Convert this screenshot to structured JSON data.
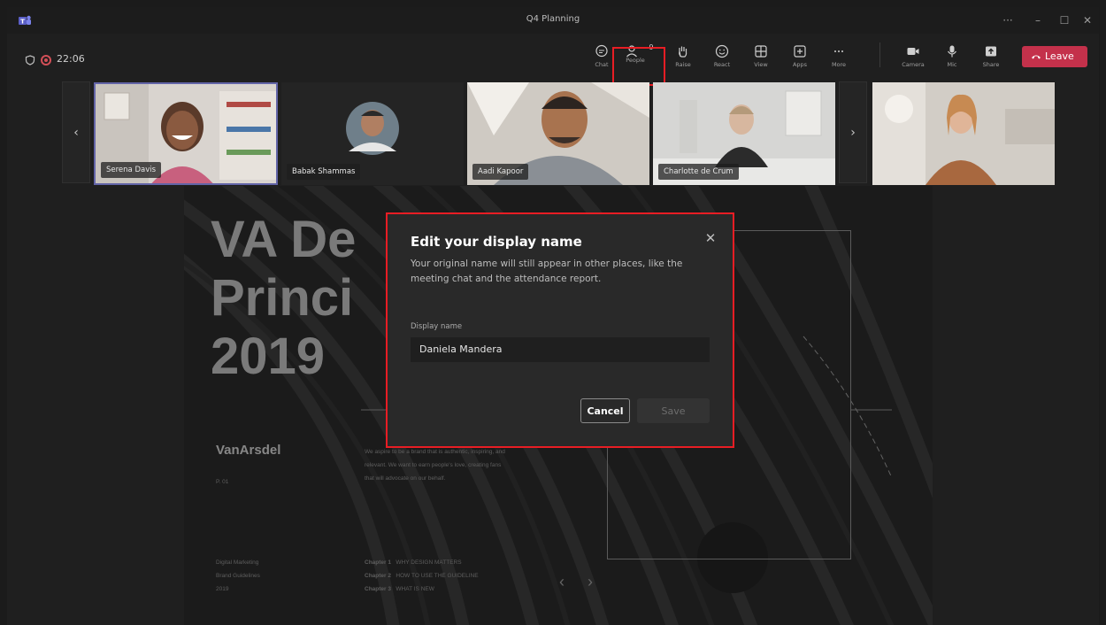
{
  "window": {
    "title": "Q4 Planning",
    "controls": {
      "more": "···",
      "minimize": "–",
      "maximize": "☐",
      "close": "✕"
    }
  },
  "meeting": {
    "timer": "22:06"
  },
  "toolbar": {
    "chat": "Chat",
    "people": "People",
    "people_count": "9",
    "raise": "Raise",
    "react": "React",
    "view": "View",
    "apps": "Apps",
    "more": "More",
    "camera": "Camera",
    "mic": "Mic",
    "share": "Share",
    "leave": "Leave",
    "leave_color": "#c4314b"
  },
  "participants": [
    {
      "name": "Serena Davis"
    },
    {
      "name": "Babak Shammas"
    },
    {
      "name": "Aadi Kapoor"
    },
    {
      "name": "Charlotte de Crum"
    },
    {
      "name": ""
    }
  ],
  "strip_nav": {
    "prev": "‹",
    "next": "›"
  },
  "slide": {
    "title_lines": [
      "VA De",
      "Princi",
      "2019"
    ],
    "brand": "VanArsdel",
    "page": "P. 01",
    "tagline_lines": [
      "We aspire to be a brand that is authentic, inspiring, and",
      "relevant. We want to earn people's love, creating fans",
      "that will advocate on our behalf."
    ],
    "footer_left": [
      "Digital Marketing",
      "Brand Guidelines",
      "2019"
    ],
    "chapters": [
      {
        "label": "Chapter 1",
        "title": "WHY DESIGN MATTERS"
      },
      {
        "label": "Chapter 2",
        "title": "HOW TO USE THE GUIDELINE"
      },
      {
        "label": "Chapter 3",
        "title": "WHAT IS NEW"
      }
    ],
    "nav_prev": "‹",
    "nav_next": "›"
  },
  "dialog": {
    "title": "Edit your display name",
    "description": "Your original name will still appear in other places, like the meeting chat and the attendance report.",
    "field_label": "Display name",
    "field_value": "Daniela Mandera",
    "cancel": "Cancel",
    "save": "Save",
    "close": "✕"
  },
  "colors": {
    "highlight": "#e81d24",
    "accent": "#6264a7"
  }
}
